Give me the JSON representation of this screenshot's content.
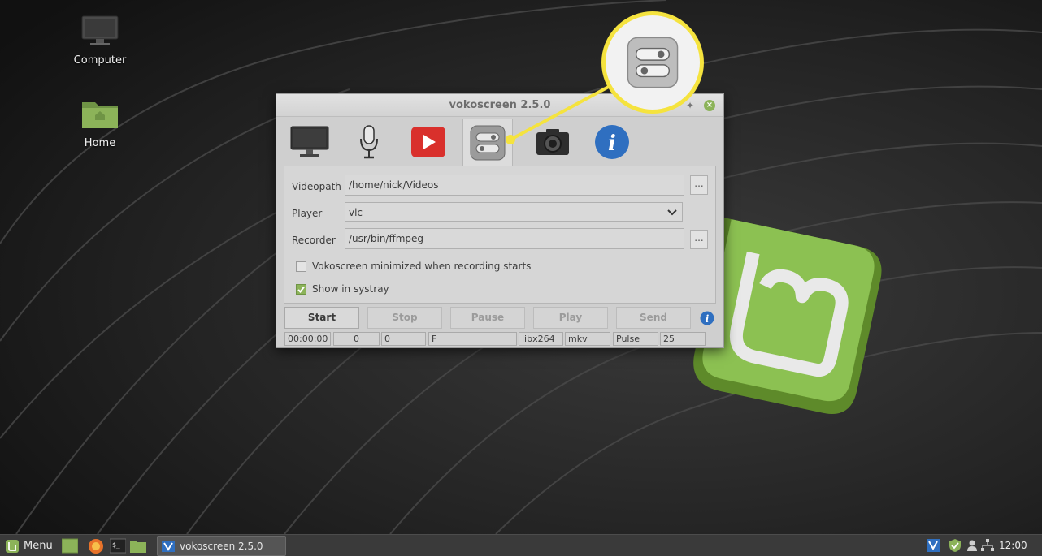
{
  "desktop": {
    "icons": [
      {
        "label": "Computer"
      },
      {
        "label": "Home"
      }
    ]
  },
  "window": {
    "title": "vokoscreen 2.5.0",
    "tabs": [
      {
        "icon": "monitor-icon"
      },
      {
        "icon": "microphone-icon"
      },
      {
        "icon": "video-play-icon"
      },
      {
        "icon": "settings-toggle-icon",
        "active": true
      },
      {
        "icon": "camera-icon"
      },
      {
        "icon": "info-icon"
      }
    ],
    "settings": {
      "videopath_label": "Videopath",
      "videopath_value": "/home/nick/Videos",
      "videopath_browse": "...",
      "player_label": "Player",
      "player_value": "vlc",
      "recorder_label": "Recorder",
      "recorder_value": "/usr/bin/ffmpeg",
      "recorder_browse": "...",
      "minimized_label": "Vokoscreen minimized when recording starts",
      "minimized_checked": false,
      "systray_label": "Show in systray",
      "systray_checked": true
    },
    "actions": {
      "start": "Start",
      "stop": "Stop",
      "pause": "Pause",
      "play": "Play",
      "send": "Send"
    },
    "status": {
      "time": "00:00:00",
      "frames": "0",
      "size": "0",
      "format": "F",
      "codec": "libx264",
      "container": "mkv",
      "audio": "Pulse",
      "fps": "25"
    }
  },
  "taskbar": {
    "menu_label": "Menu",
    "task_label": "vokoscreen 2.5.0",
    "clock": "12:00"
  },
  "colors": {
    "mint_green": "#8cb359",
    "callout_yellow": "#f5e33e",
    "info_blue": "#2f6fc0",
    "record_red": "#d9302c"
  }
}
